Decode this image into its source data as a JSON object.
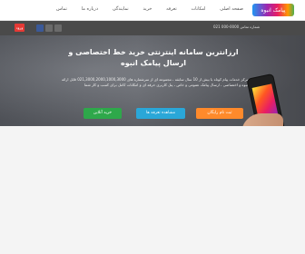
{
  "header": {
    "logo_text": "پیامک انبوه",
    "nav_items": [
      "صفحه اصلی",
      "امکانات",
      "تعرفه",
      "خرید",
      "نمایندگی",
      "درباره ما",
      "تماس"
    ]
  },
  "subbar": {
    "login_label": "ورود",
    "contact": "شماره تماس 0000-000 021"
  },
  "hero": {
    "title": "ارزانترین سامانه اینترنتی خرید خط اختصاصی و ارسال پیامک انبوه",
    "description": "مرکز خدمات پیام کوتاه با بیش از 10 سال سابقه ، مجموعه ای از سرشماره های 021,3000,2000,1000,3000 قابل ارائه انبوه و اختصاصی ، ارسال پیامک عمومی و خاص ، پنل کاربری حرفه ای و امکانات کامل برای کسب و کار شما"
  },
  "cta": {
    "orange": "ثبت نام رایگان",
    "blue": "مشاهده تعرفه ها",
    "green": "خرید آنلاین"
  },
  "colors": {
    "accent_red": "#e53935",
    "cta_orange": "#ff8a2b",
    "cta_blue": "#2aa7d8",
    "cta_green": "#2ea84a"
  }
}
